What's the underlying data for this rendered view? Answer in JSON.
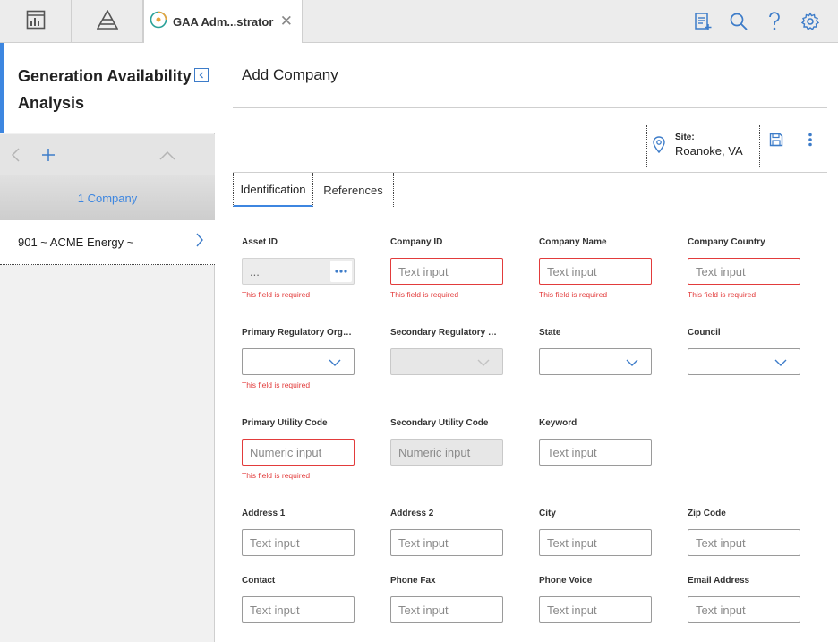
{
  "tabs": {
    "active_label": "GAA Adm...strator"
  },
  "sidebar": {
    "title": "Generation Availability Analysis",
    "count_label": "1 Company",
    "items": [
      {
        "label": "901 ~ ACME Energy ~"
      }
    ]
  },
  "main": {
    "title": "Add Company",
    "site_label": "Site:",
    "site_value": "Roanoke, VA",
    "tabs": [
      {
        "label": "Identification"
      },
      {
        "label": "References"
      }
    ]
  },
  "form": {
    "asset_id": {
      "label": "Asset ID",
      "value": "...",
      "error": "This field is required"
    },
    "company_id": {
      "label": "Company ID",
      "placeholder": "Text input",
      "error": "This field is required"
    },
    "company_name": {
      "label": "Company Name",
      "placeholder": "Text input",
      "error": "This field is required"
    },
    "company_country": {
      "label": "Company Country",
      "placeholder": "Text input",
      "error": "This field is required"
    },
    "primary_reg_org": {
      "label": "Primary Regulatory Organ...",
      "error": "This field is required"
    },
    "secondary_reg_org": {
      "label": "Secondary Regulatory Org..."
    },
    "state": {
      "label": "State"
    },
    "council": {
      "label": "Council"
    },
    "primary_utility_code": {
      "label": "Primary Utility Code",
      "placeholder": "Numeric input",
      "error": "This field is required"
    },
    "secondary_utility_code": {
      "label": "Secondary Utility Code",
      "placeholder": "Numeric input"
    },
    "keyword": {
      "label": "Keyword",
      "placeholder": "Text input"
    },
    "address1": {
      "label": "Address 1",
      "placeholder": "Text input"
    },
    "address2": {
      "label": "Address 2",
      "placeholder": "Text input"
    },
    "city": {
      "label": "City",
      "placeholder": "Text input"
    },
    "zip_code": {
      "label": "Zip Code",
      "placeholder": "Text input"
    },
    "contact": {
      "label": "Contact",
      "placeholder": "Text input"
    },
    "phone_fax": {
      "label": "Phone Fax",
      "placeholder": "Text input"
    },
    "phone_voice": {
      "label": "Phone Voice",
      "placeholder": "Text input"
    },
    "email_address": {
      "label": "Email Address",
      "placeholder": "Text input"
    }
  },
  "colors": {
    "accent": "#3d86e0",
    "error": "#e23b3b"
  },
  "icons": [
    "dashboard-icon",
    "pyramid-icon",
    "gaa-app-icon",
    "close-icon",
    "new-record-icon",
    "search-icon",
    "help-icon",
    "gear-icon",
    "collapse-left-icon",
    "back-icon",
    "plus-icon",
    "chevron-up-icon",
    "chevron-right-icon",
    "location-pin-icon",
    "save-icon",
    "more-vertical-icon",
    "ellipsis-icon",
    "chevron-down-icon"
  ]
}
